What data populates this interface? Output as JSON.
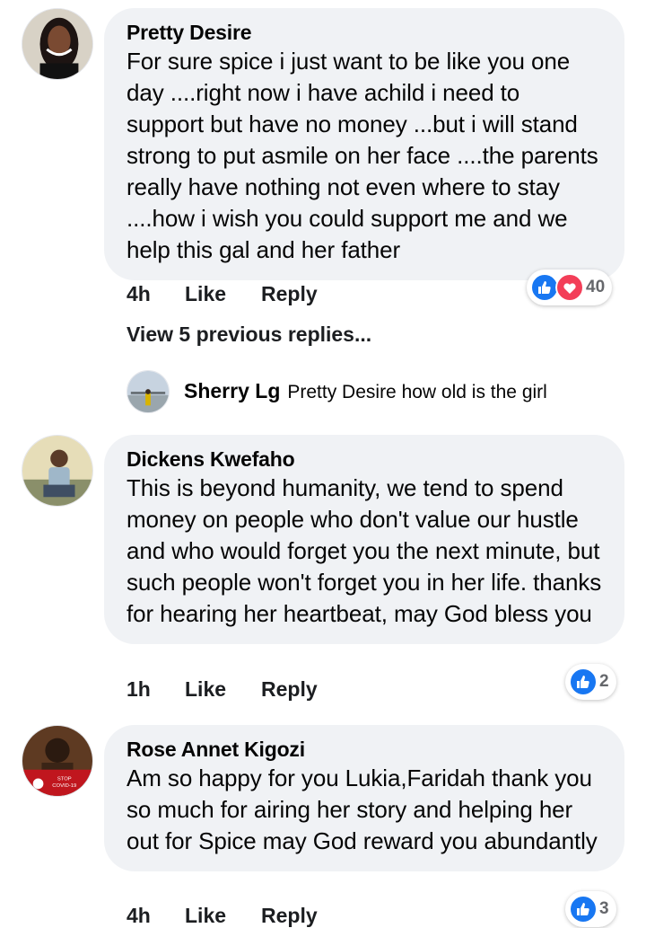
{
  "comments": [
    {
      "author": "Pretty Desire",
      "text": "For sure spice i just want to be like you one day ....right now i have achild i need to support but have no money ...but i will stand strong to put asmile on her face ....the parents really have nothing not even where to stay ....how i wish you could support me and we help this gal and her father",
      "time": "4h",
      "like_label": "Like",
      "reply_label": "Reply",
      "reaction_count": "40",
      "reactions": [
        "like-icon",
        "love-icon"
      ]
    },
    {
      "author": "Dickens Kwefaho",
      "text": "This is beyond humanity, we tend to spend money on people who don't value our hustle and who would forget you the next minute, but such people won't forget you in her life. thanks for hearing her heartbeat, may God bless you",
      "time": "1h",
      "like_label": "Like",
      "reply_label": "Reply",
      "reaction_count": "2",
      "reactions": [
        "like-icon"
      ]
    },
    {
      "author": "Rose Annet Kigozi",
      "text": "Am so happy for you Lukia,Faridah thank you so much for airing her story and helping her out for Spice may God reward you abundantly",
      "time": "4h",
      "like_label": "Like",
      "reply_label": "Reply",
      "reaction_count": "3",
      "reactions": [
        "like-icon"
      ]
    }
  ],
  "view_previous": "View 5 previous replies...",
  "reply": {
    "author": "Sherry Lg",
    "text": "Pretty Desire how old is the girl"
  },
  "avatar_badge": {
    "line1": "STOP",
    "line2": "COVID-19"
  },
  "colors": {
    "bubble": "#f0f2f5",
    "like_blue": "#1877f2",
    "love_red": "#f33e58",
    "muted": "#65676b"
  }
}
